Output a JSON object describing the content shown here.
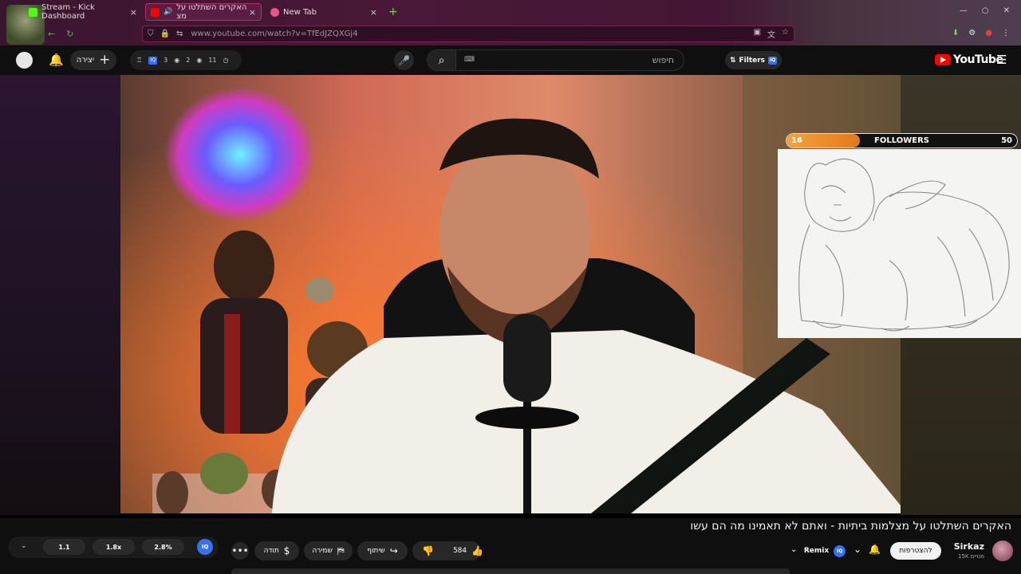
{
  "browser": {
    "tabs": [
      {
        "title": "Stream - Kick Dashboard",
        "fav_color": "#53fc18",
        "close": "×"
      },
      {
        "title": "האקרים השתלטו על מצ",
        "fav_color": "#ff0000",
        "close": "×"
      },
      {
        "title": "New Tab",
        "fav_color": "#e8558a",
        "close": "×"
      }
    ],
    "newtab_glyph": "+",
    "url": "www.youtube.com/watch?v=TfEdJZQXGj4",
    "nav_back": "←",
    "nav_reload": "↻"
  },
  "header": {
    "create_label": "יצירה",
    "create_plus": "+",
    "bell": "🔔",
    "stats": [
      "3",
      "2",
      "11"
    ],
    "iq_label": "IQ",
    "search_placeholder": "חיפוש",
    "search_kbd": "⌨",
    "search_glyph": "⌕",
    "mic_glyph": "🎤",
    "filters_label": "Filters",
    "filters_icon": "⇅",
    "logo_text": "YouTube",
    "menu_glyph": "☰"
  },
  "overlay": {
    "followers_label": "FOLLOWERS",
    "current": "16",
    "goal": "50",
    "progress": 0.32
  },
  "video": {
    "title": "האקרים השתלטו על מצלמות ביתיות - ואתם לא תאמינו מה הם עשו"
  },
  "controls": {
    "speeds": [
      "1.1",
      "1.8x",
      "2.8%"
    ],
    "iq_label": "IQ",
    "chevron": "⌄",
    "more": "•••",
    "thanks_label": "תודה",
    "save_label": "שמירה",
    "share_label": "שיתוף",
    "likes": "584",
    "subscribe_label": "להצטרפות",
    "remix_label": "Remix",
    "channel_name": "Sirkaz",
    "channel_subs": "15K מנויים"
  },
  "colors": {
    "accent_red": "#ff0000",
    "iq_blue": "#3a6ff0",
    "followers_orange": "#f5a23a",
    "tab_border": "#c02b62"
  }
}
